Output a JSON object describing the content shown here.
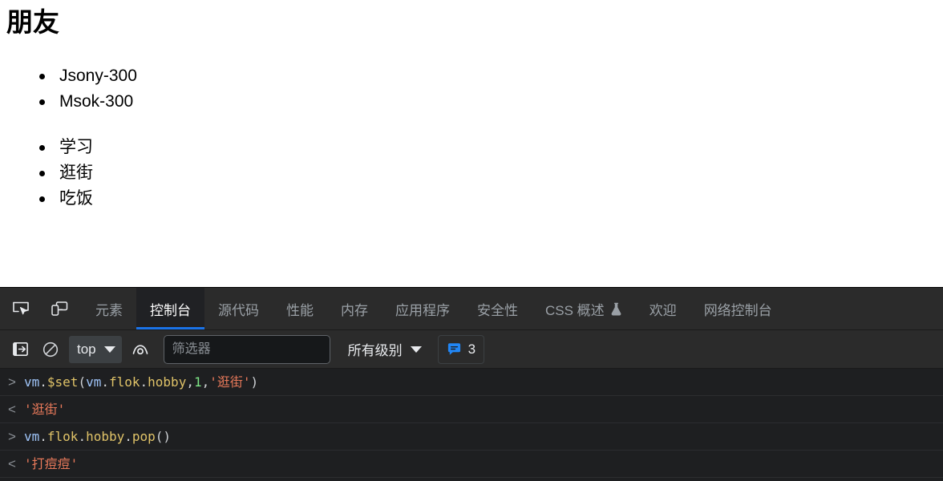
{
  "page": {
    "title": "朋友",
    "lists": [
      {
        "items": [
          "Jsony-300",
          "Msok-300"
        ]
      },
      {
        "items": [
          "学习",
          "逛街",
          "吃饭"
        ]
      }
    ]
  },
  "devtools": {
    "toolbar_icons": [
      {
        "name": "inspect-element-icon",
        "title": "检查元素"
      },
      {
        "name": "device-toolbar-icon",
        "title": "切换设备工具栏"
      }
    ],
    "tabs": [
      {
        "label": "元素",
        "active": false,
        "experimental": false
      },
      {
        "label": "控制台",
        "active": true,
        "experimental": false
      },
      {
        "label": "源代码",
        "active": false,
        "experimental": false
      },
      {
        "label": "性能",
        "active": false,
        "experimental": false
      },
      {
        "label": "内存",
        "active": false,
        "experimental": false
      },
      {
        "label": "应用程序",
        "active": false,
        "experimental": false
      },
      {
        "label": "安全性",
        "active": false,
        "experimental": false
      },
      {
        "label": "CSS 概述",
        "active": false,
        "experimental": true
      },
      {
        "label": "欢迎",
        "active": false,
        "experimental": false
      },
      {
        "label": "网络控制台",
        "active": false,
        "experimental": false
      }
    ],
    "console_toolbar": {
      "sidebar_toggle_icon": "console-sidebar-icon",
      "clear_console_icon": "clear-console-icon",
      "context": "top",
      "live_expression_icon": "eye-icon",
      "filter_placeholder": "筛选器",
      "filter_value": "",
      "levels_label": "所有级别",
      "message_count": "3"
    },
    "console_rows": [
      {
        "kind": "input",
        "marker": ">",
        "tokens": [
          {
            "t": "vm",
            "c": "tok-obj"
          },
          {
            "t": ".",
            "c": "tok-punct"
          },
          {
            "t": "$set",
            "c": "tok-prop"
          },
          {
            "t": "(",
            "c": "tok-paren"
          },
          {
            "t": "vm",
            "c": "tok-obj"
          },
          {
            "t": ".",
            "c": "tok-punct"
          },
          {
            "t": "flok",
            "c": "tok-prop"
          },
          {
            "t": ".",
            "c": "tok-punct"
          },
          {
            "t": "hobby",
            "c": "tok-prop"
          },
          {
            "t": ",",
            "c": "tok-punct"
          },
          {
            "t": "1",
            "c": "tok-num"
          },
          {
            "t": ",",
            "c": "tok-punct"
          },
          {
            "t": "'逛街'",
            "c": "tok-str"
          },
          {
            "t": ")",
            "c": "tok-paren"
          }
        ],
        "text": "vm.$set(vm.flok.hobby,1,'逛街')"
      },
      {
        "kind": "output",
        "marker": "<",
        "tokens": [
          {
            "t": "'逛街'",
            "c": "out-str"
          }
        ],
        "text": "'逛街'"
      },
      {
        "kind": "input",
        "marker": ">",
        "tokens": [
          {
            "t": "vm",
            "c": "tok-obj"
          },
          {
            "t": ".",
            "c": "tok-punct"
          },
          {
            "t": "flok",
            "c": "tok-prop"
          },
          {
            "t": ".",
            "c": "tok-punct"
          },
          {
            "t": "hobby",
            "c": "tok-prop"
          },
          {
            "t": ".",
            "c": "tok-punct"
          },
          {
            "t": "pop",
            "c": "tok-prop"
          },
          {
            "t": "()",
            "c": "tok-paren"
          }
        ],
        "text": "vm.flok.hobby.pop()"
      },
      {
        "kind": "output",
        "marker": "<",
        "tokens": [
          {
            "t": "'打痘痘'",
            "c": "out-str"
          }
        ],
        "text": "'打痘痘'"
      }
    ]
  },
  "colors": {
    "accent_blue": "#1a73e8",
    "devtools_bg": "#202124",
    "toolbar_bg": "#2b2b2b",
    "console_bg": "#1e1f21",
    "string_orange": "#e8795a",
    "number_green": "#7ee787",
    "property_yellow": "#e0c368",
    "object_blue": "#9fc4f8"
  }
}
